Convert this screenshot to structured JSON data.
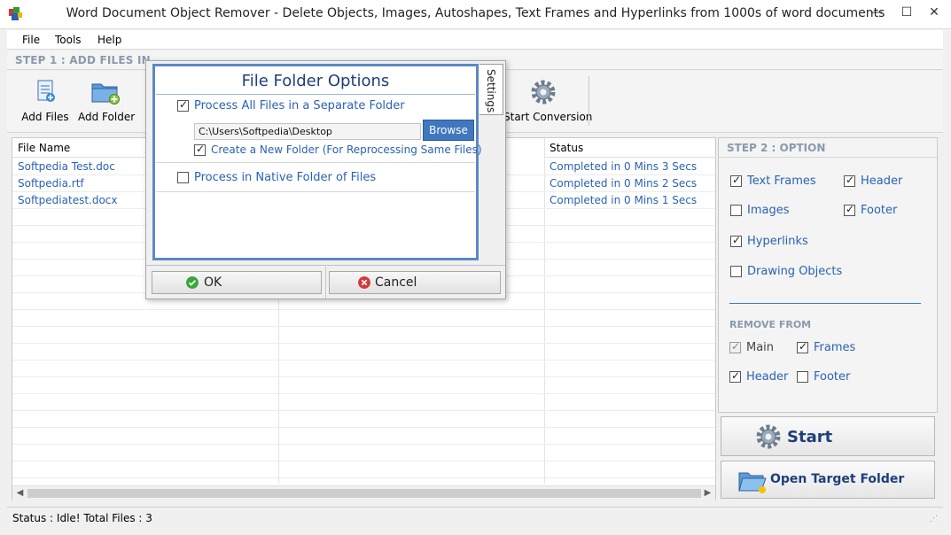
{
  "window": {
    "title": "Word Document Object Remover - Delete Objects, Images, Autoshapes, Text Frames and Hyperlinks from 1000s of word documents",
    "minimize": "—",
    "maximize": "☐",
    "close": "✕"
  },
  "menu": [
    "File",
    "Tools",
    "Help"
  ],
  "step1": {
    "title": "STEP 1 : ADD FILES IN"
  },
  "toolbar": {
    "add_files": "Add Files",
    "add_folder": "Add Folder",
    "start_conversion": "Start Conversion"
  },
  "table": {
    "headers": {
      "file_name": "File Name",
      "status": "Status"
    },
    "rows": [
      {
        "file": "Softpedia Test.doc",
        "status": "Completed in 0 Mins 3 Secs"
      },
      {
        "file": "Softpedia.rtf",
        "status": "Completed in 0 Mins 2 Secs"
      },
      {
        "file": "Softpediatest.docx",
        "status": "Completed in 0 Mins 1 Secs"
      }
    ]
  },
  "step2": {
    "title": "STEP 2 : OPTION",
    "options": {
      "text_frames": {
        "label": "Text Frames",
        "checked": true
      },
      "header": {
        "label": "Header",
        "checked": true
      },
      "images": {
        "label": "Images",
        "checked": false
      },
      "footer": {
        "label": "Footer",
        "checked": true
      },
      "hyperlinks": {
        "label": "Hyperlinks",
        "checked": true
      },
      "drawing_objects": {
        "label": "Drawing Objects",
        "checked": false
      }
    },
    "remove_from_title": "REMOVE FROM",
    "remove_from": {
      "main": {
        "label": "Main",
        "checked": true,
        "disabled": true
      },
      "frames": {
        "label": "Frames",
        "checked": true
      },
      "header": {
        "label": "Header",
        "checked": true
      },
      "footer": {
        "label": "Footer",
        "checked": false
      }
    }
  },
  "buttons": {
    "start": "Start",
    "open_target": "Open Target Folder"
  },
  "status": {
    "text": "Status  :  Idle!  Total Files : 3"
  },
  "dialog": {
    "title": "File Folder Options",
    "process_separate": {
      "label": "Process All Files in a Separate Folder",
      "checked": true
    },
    "path": "C:\\Users\\Softpedia\\Desktop",
    "browse": "Browse",
    "create_new": {
      "label": "Create a New Folder (For Reprocessing Same Files)",
      "checked": true
    },
    "process_native": {
      "label": "Process in Native Folder of Files",
      "checked": false
    },
    "settings_tab": "Settings",
    "ok": "OK",
    "cancel": "Cancel"
  },
  "colors": {
    "link_blue": "#2a62b3",
    "header_gray": "#8a9aac",
    "dialog_border": "#5b8ac4",
    "browse_bg": "#3f78be",
    "title_navy": "#1f3f7a"
  }
}
